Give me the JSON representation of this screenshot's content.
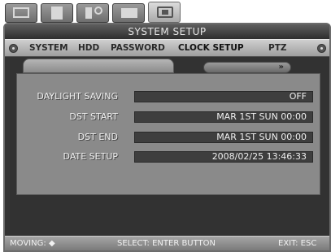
{
  "title": "SYSTEM SETUP",
  "top_icons": [
    "monitor-icon",
    "document-icon",
    "network-icon",
    "camera-icon",
    "settings-icon"
  ],
  "menu": {
    "items": [
      {
        "label": "SYSTEM"
      },
      {
        "label": "HDD"
      },
      {
        "label": "PASSWORD"
      },
      {
        "label": "CLOCK SETUP"
      },
      {
        "label": "PTZ"
      }
    ],
    "active": "CLOCK SETUP"
  },
  "subtab": {
    "more_label": "»"
  },
  "settings": [
    {
      "label": "DAYLIGHT SAVING",
      "value": "OFF"
    },
    {
      "label": "DST START",
      "value": "MAR 1ST SUN 00:00"
    },
    {
      "label": "DST END",
      "value": "MAR 1ST SUN 00:00"
    },
    {
      "label": "DATE SETUP",
      "value": "2008/02/25 13:46:33"
    }
  ],
  "status": {
    "moving": "MOVING:",
    "moving_icon": "◆",
    "select": "SELECT: ENTER BUTTON",
    "exit": "EXIT: ESC"
  }
}
